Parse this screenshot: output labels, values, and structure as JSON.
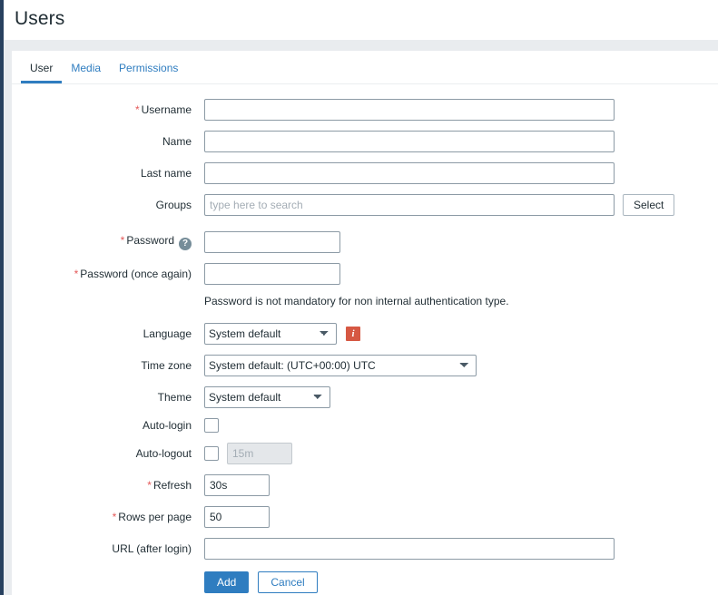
{
  "page": {
    "title": "Users"
  },
  "colors": {
    "accent": "#2f7dc0",
    "required": "#e45959",
    "info_icon_bg": "#d65843",
    "sidebar_edge": "#28415f",
    "page_bg": "#e9ecef"
  },
  "tabs": [
    {
      "label": "User",
      "active": true
    },
    {
      "label": "Media",
      "active": false
    },
    {
      "label": "Permissions",
      "active": false
    }
  ],
  "form": {
    "username": {
      "label": "Username",
      "required": "*",
      "value": "",
      "placeholder": ""
    },
    "name": {
      "label": "Name",
      "value": "",
      "placeholder": ""
    },
    "last_name": {
      "label": "Last name",
      "value": "",
      "placeholder": ""
    },
    "groups": {
      "label": "Groups",
      "value": "",
      "placeholder": "type here to search",
      "select_button": "Select"
    },
    "password": {
      "label": "Password",
      "required": "*",
      "help_icon": "question-mark-icon",
      "help_glyph": "?",
      "value": ""
    },
    "password_again": {
      "label": "Password (once again)",
      "required": "*",
      "value": ""
    },
    "password_hint": "Password is not mandatory for non internal authentication type.",
    "language": {
      "label": "Language",
      "value": "System default",
      "options": [
        "System default"
      ],
      "info_icon": "info-icon",
      "info_glyph": "i"
    },
    "timezone": {
      "label": "Time zone",
      "value": "System default: (UTC+00:00) UTC",
      "options": [
        "System default: (UTC+00:00) UTC"
      ]
    },
    "theme": {
      "label": "Theme",
      "value": "System default",
      "options": [
        "System default"
      ]
    },
    "auto_login": {
      "label": "Auto-login",
      "checked": false
    },
    "auto_logout": {
      "label": "Auto-logout",
      "checked": false,
      "value": "15m",
      "disabled": true
    },
    "refresh": {
      "label": "Refresh",
      "required": "*",
      "value": "30s"
    },
    "rows_per_page": {
      "label": "Rows per page",
      "required": "*",
      "value": "50"
    },
    "url_after_login": {
      "label": "URL (after login)",
      "value": "",
      "placeholder": ""
    }
  },
  "actions": {
    "add_label": "Add",
    "cancel_label": "Cancel"
  }
}
